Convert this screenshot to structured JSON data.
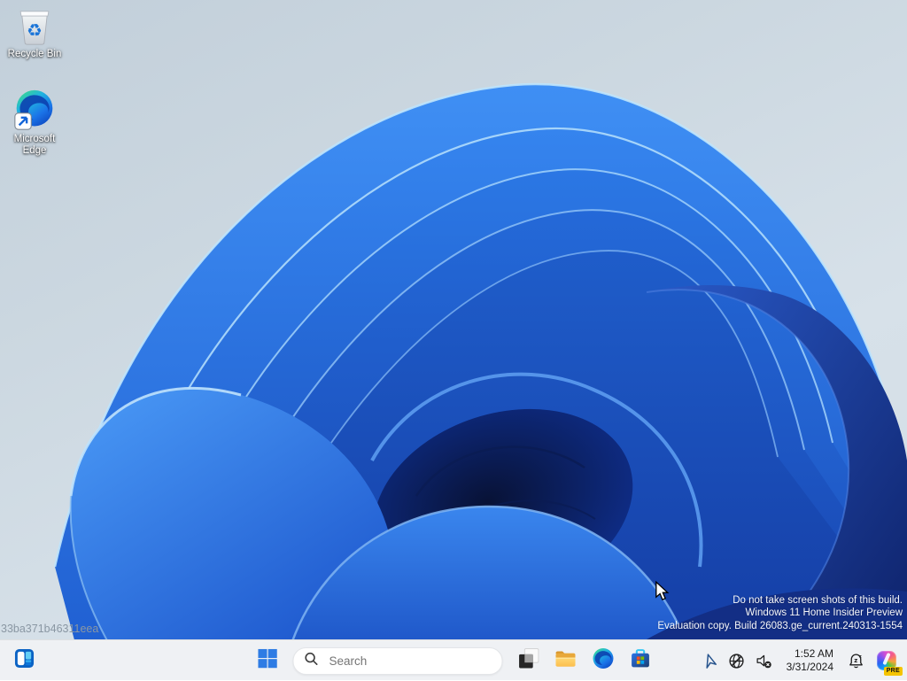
{
  "desktop": {
    "icons": [
      {
        "label": "Recycle Bin",
        "icon": "recycle-bin"
      },
      {
        "label": "Microsoft Edge",
        "icon": "microsoft-edge-shortcut"
      }
    ],
    "watermark_left": "33ba371b46311eea",
    "watermark_right": {
      "line1": "Do not take screen shots of this build.",
      "line2": "Windows 11 Home Insider Preview",
      "line3": "Evaluation copy. Build 26083.ge_current.240313-1554"
    }
  },
  "taskbar": {
    "widgets": {
      "icon": "widgets-board"
    },
    "start": {
      "icon": "windows-logo"
    },
    "search": {
      "placeholder": "Search",
      "icon": "magnifier"
    },
    "pinned": [
      {
        "icon": "task-view"
      },
      {
        "icon": "file-explorer-folder"
      },
      {
        "icon": "microsoft-edge"
      },
      {
        "icon": "microsoft-store"
      }
    ],
    "tray": {
      "icons": [
        "location-arrow",
        "globe-no-internet",
        "volume-muted"
      ],
      "time": "1:52 AM",
      "date": "3/31/2024",
      "bell": "notification-bell-dnd",
      "copilot_badge": "PRE"
    }
  },
  "colors": {
    "taskbar_bg": "#eff1f4",
    "accent_blue": "#2e7ce6",
    "bloom_bright": "#2f7ce8",
    "bloom_dark": "#0c1c55",
    "watermark_gray": "#8a97a3"
  }
}
